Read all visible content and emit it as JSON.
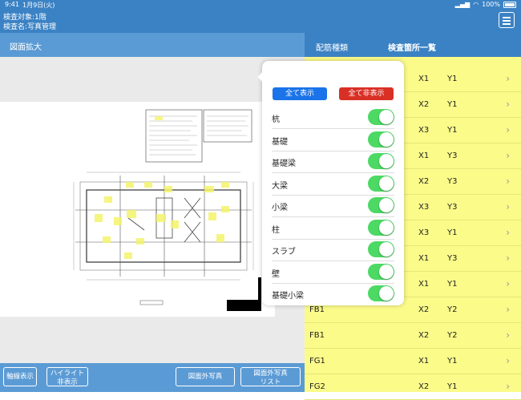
{
  "status": {
    "time": "9:41",
    "date": "1月9日(火)",
    "battery": "100%"
  },
  "header": {
    "line1": "検査対象:1階",
    "line2": "検査名:写真管理"
  },
  "left_panel": {
    "title": "図面拡大"
  },
  "right_tabs": {
    "tab1": "配筋種類",
    "tab2": "検査箇所一覧"
  },
  "bottom_buttons": {
    "axis": "軸線表示",
    "highlight_1": "ハイライト",
    "highlight_2": "非表示",
    "outside_photo": "図面外写真",
    "outside_list_1": "図面外写真",
    "outside_list_2": "リスト"
  },
  "popup": {
    "show_all": "全て表示",
    "hide_all": "全て非表示",
    "show_all_color": "#1a73e8",
    "hide_all_color": "#d93025",
    "items": [
      {
        "label": "杭",
        "on": true
      },
      {
        "label": "基礎",
        "on": true
      },
      {
        "label": "基礎梁",
        "on": true
      },
      {
        "label": "大梁",
        "on": true
      },
      {
        "label": "小梁",
        "on": true
      },
      {
        "label": "柱",
        "on": true
      },
      {
        "label": "スラブ",
        "on": true
      },
      {
        "label": "壁",
        "on": true
      },
      {
        "label": "基礎小梁",
        "on": true
      }
    ]
  },
  "list_rows": [
    {
      "name": "",
      "x": "X1",
      "y": "Y1"
    },
    {
      "name": "",
      "x": "X2",
      "y": "Y1"
    },
    {
      "name": "",
      "x": "X3",
      "y": "Y1"
    },
    {
      "name": "",
      "x": "X1",
      "y": "Y3"
    },
    {
      "name": "",
      "x": "X2",
      "y": "Y3"
    },
    {
      "name": "",
      "x": "X3",
      "y": "Y3"
    },
    {
      "name": "",
      "x": "X3",
      "y": "Y1"
    },
    {
      "name": "",
      "x": "X1",
      "y": "Y3"
    },
    {
      "name": "",
      "x": "X1",
      "y": "Y1"
    },
    {
      "name": "FB1",
      "x": "X2",
      "y": "Y2"
    },
    {
      "name": "FB1",
      "x": "X2",
      "y": "Y2"
    },
    {
      "name": "FG1",
      "x": "X1",
      "y": "Y1"
    },
    {
      "name": "FG2",
      "x": "X2",
      "y": "Y1"
    }
  ],
  "colors": {
    "header": "#3b82c4",
    "list_bg": "#fbfb8a",
    "toggle_on": "#4cd964"
  }
}
